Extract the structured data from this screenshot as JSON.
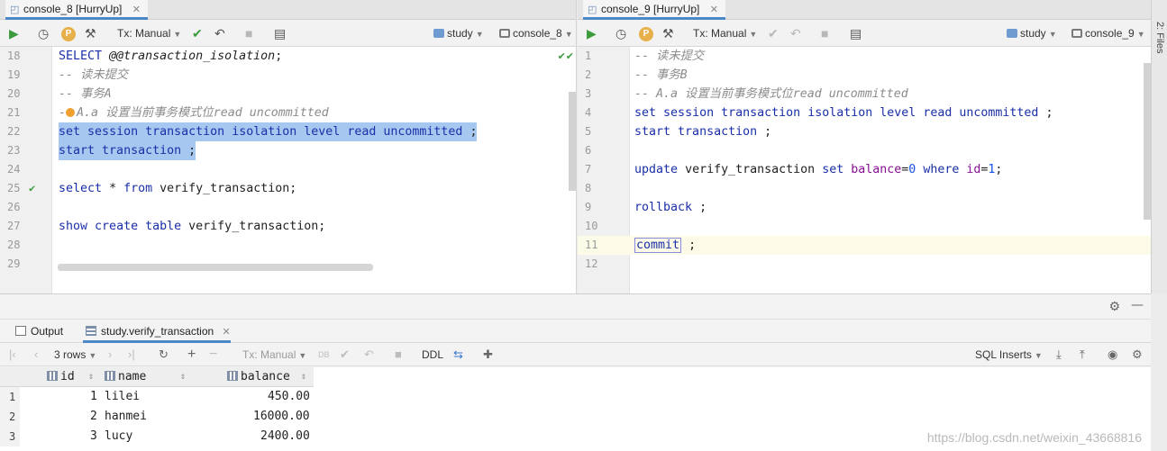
{
  "left": {
    "tab": {
      "title": "console_8 [HurryUp]"
    },
    "toolbar": {
      "tx": "Tx: Manual",
      "db": "study",
      "console": "console_8"
    },
    "lines": [
      {
        "n": "18",
        "kind": "sql1"
      },
      {
        "n": "19",
        "text": "-- 读未提交"
      },
      {
        "n": "20",
        "text": "-- 事务A"
      },
      {
        "n": "21",
        "text": "A.a 设置当前事务模式位read uncommitted"
      },
      {
        "n": "22",
        "text": "set session transaction isolation level read uncommitted ;"
      },
      {
        "n": "23",
        "text": "start transaction ;"
      },
      {
        "n": "24",
        "text": ""
      },
      {
        "n": "25",
        "text": "select * from verify_transaction;"
      },
      {
        "n": "26",
        "text": ""
      },
      {
        "n": "27",
        "text": "show create table verify_transaction;"
      },
      {
        "n": "28",
        "text": ""
      },
      {
        "n": "29",
        "text": ""
      }
    ],
    "l18": {
      "kw": "SELECT",
      "var": "@@transaction_isolation",
      "end": ";"
    },
    "l21": {
      "prefix": "-",
      "rest": "A.a 设置当前事务模式位read uncommitted"
    },
    "l22": {
      "s1": "set",
      "s2": "session",
      "s3": "transaction",
      "s4": "isolation",
      "s5": "level",
      "s6": "read",
      "s7": "uncommitted",
      "s8": ";"
    },
    "l23": {
      "s1": "start",
      "s2": "transaction",
      "s3": ";"
    },
    "l25": {
      "s1": "select",
      "s2": "*",
      "s3": "from",
      "s4": "verify_transaction;"
    },
    "l27": {
      "s1": "show",
      "s2": "create",
      "s3": "table",
      "s4": "verify_transaction;"
    }
  },
  "right": {
    "tab": {
      "title": "console_9 [HurryUp]"
    },
    "toolbar": {
      "tx": "Tx: Manual",
      "db": "study",
      "console": "console_9"
    },
    "nums": [
      "1",
      "2",
      "3",
      "4",
      "5",
      "6",
      "7",
      "8",
      "9",
      "10",
      "11",
      "12"
    ],
    "l1": "-- 读未提交",
    "l2": "-- 事务B",
    "l3": "-- A.a 设置当前事务模式位read uncommitted",
    "l4": {
      "s1": "set",
      "s2": "session",
      "s3": "transaction",
      "s4": "isolation",
      "s5": "level",
      "s6": "read",
      "s7": "uncommitted",
      "s8": ";"
    },
    "l5": {
      "s1": "start",
      "s2": "transaction",
      "s3": ";"
    },
    "l7": {
      "s1": "update",
      "s2": "verify_transaction",
      "s3": "set",
      "s4": "balance",
      "s5": "=",
      "s6": "0",
      "s7": "where",
      "s8": "id",
      "s9": "=",
      "s10": "1",
      "s11": ";"
    },
    "l9": {
      "s1": "rollback",
      "s2": ";"
    },
    "l11": {
      "s1": "commit",
      "s2": ";"
    }
  },
  "strip": {
    "label": "2: Files"
  },
  "bottom": {
    "tabs": [
      {
        "label": "Output"
      },
      {
        "label": "study.verify_transaction"
      }
    ],
    "toolbar": {
      "rows": "3 rows",
      "tx": "Tx: Manual",
      "ddl": "DDL",
      "db": "DB",
      "sql_inserts": "SQL Inserts"
    },
    "grid": {
      "columns": [
        "id",
        "name",
        "balance"
      ],
      "rows": [
        {
          "num": "1",
          "id": "1",
          "name": "lilei",
          "balance": "450.00"
        },
        {
          "num": "2",
          "id": "2",
          "name": "hanmei",
          "balance": "16000.00"
        },
        {
          "num": "3",
          "id": "3",
          "name": "lucy",
          "balance": "2400.00"
        }
      ]
    },
    "watermark_url": "https://blog.csdn.net/weixin_43668816"
  },
  "colors": {
    "accent": "#4a88c7",
    "selection": "#a6c8f0",
    "keyword": "#1b2fa8",
    "comment": "#8c8c8c",
    "run": "#3c9c3c"
  }
}
